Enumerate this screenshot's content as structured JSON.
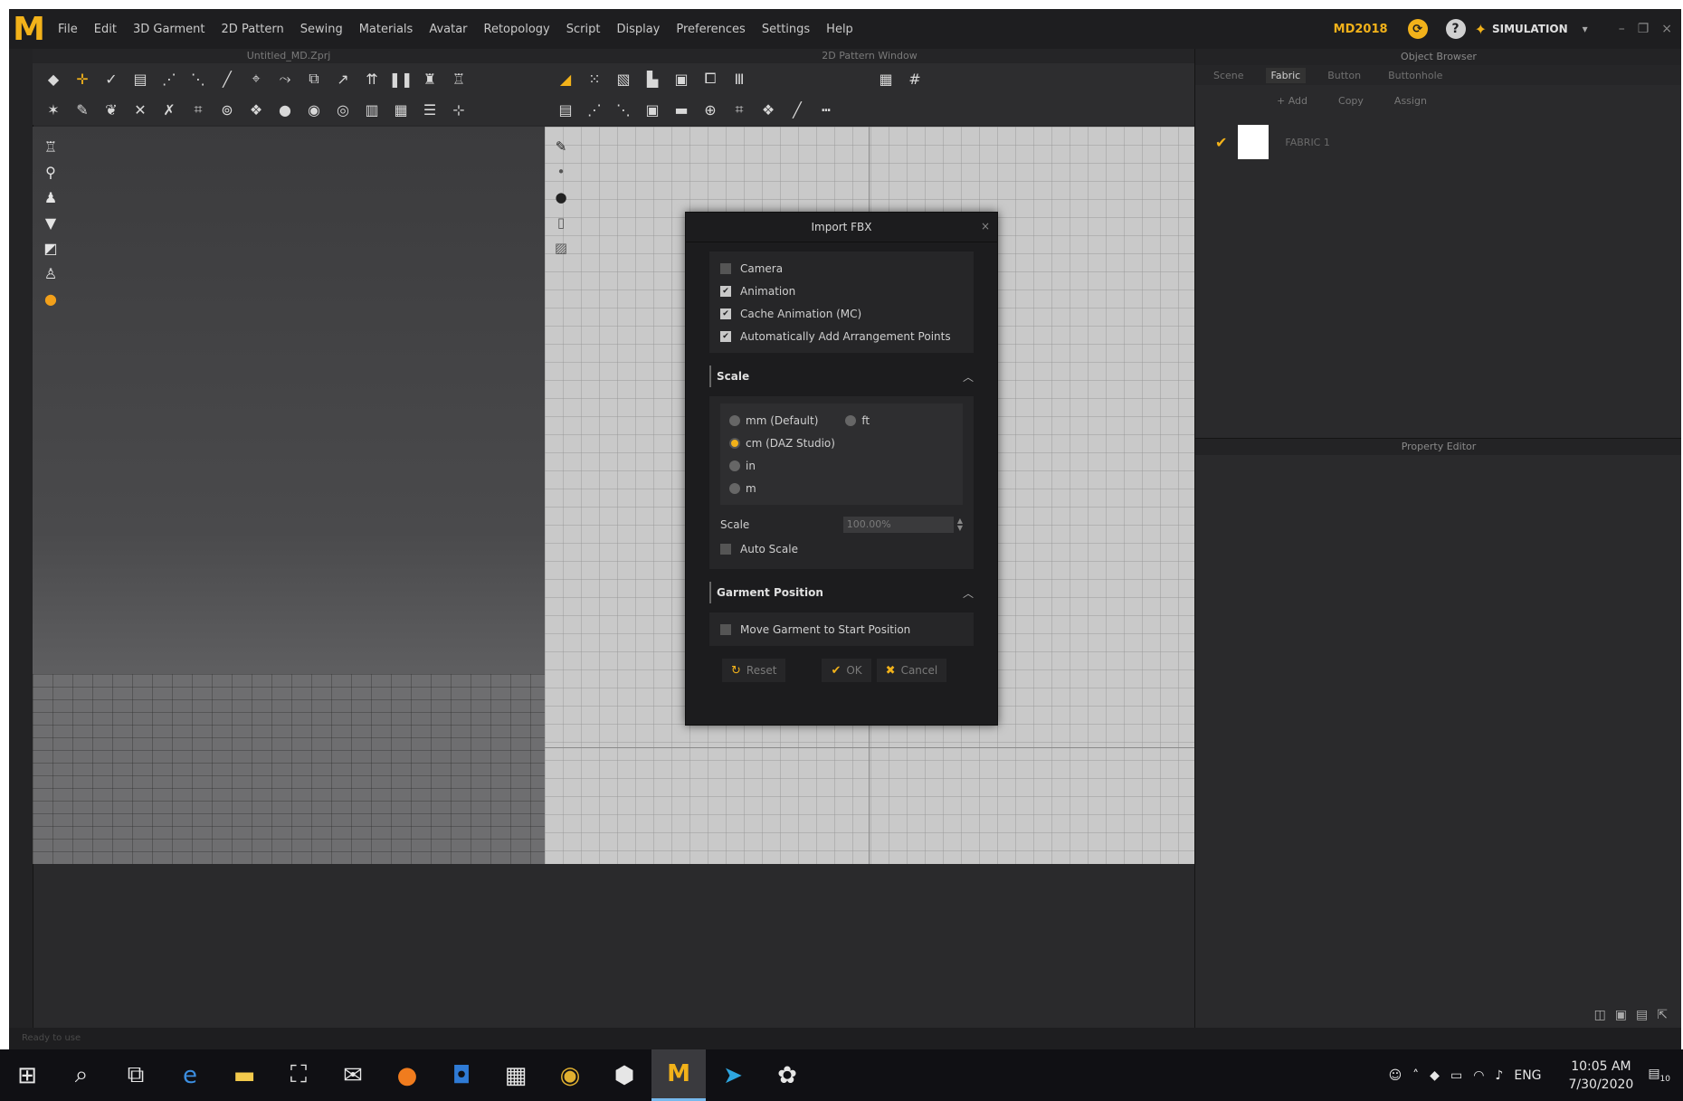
{
  "app": {
    "logo_letter": "M",
    "menu": [
      "File",
      "Edit",
      "3D Garment",
      "2D Pattern",
      "Sewing",
      "Materials",
      "Avatar",
      "Retopology",
      "Script",
      "Display",
      "Preferences",
      "Settings",
      "Help"
    ],
    "version_label": "MD2018",
    "mode_label": "SIMULATION",
    "accent_color": "#f2b21a"
  },
  "panels": {
    "panel3d_title": "Untitled_MD.Zprj",
    "panel2d_title": "2D Pattern Window",
    "object_browser_title": "Object Browser",
    "property_editor_title": "Property Editor"
  },
  "object_browser": {
    "tabs": [
      "Scene",
      "Fabric",
      "Button",
      "Buttonhole"
    ],
    "active_tab": "Fabric",
    "add_label": "+ Add",
    "copy_label": "Copy",
    "assign_label": "Assign",
    "fabric_name": "FABRIC 1"
  },
  "dialog": {
    "title": "Import FBX",
    "close": "×",
    "options": [
      {
        "label": "Camera",
        "checked": false
      },
      {
        "label": "Animation",
        "checked": true
      },
      {
        "label": "Cache Animation (MC)",
        "checked": true
      },
      {
        "label": "Automatically Add Arrangement Points",
        "checked": true
      }
    ],
    "scale_header": "Scale",
    "units": {
      "mm": "mm (Default)",
      "ft": "ft",
      "cm": "cm (DAZ Studio)",
      "in": "in",
      "m": "m",
      "selected": "cm"
    },
    "scale_label": "Scale",
    "scale_value": "100.00%",
    "auto_scale_label": "Auto Scale",
    "garment_position_header": "Garment Position",
    "move_garment_label": "Move Garment to Start Position",
    "reset_label": "Reset",
    "ok_label": "OK",
    "cancel_label": "Cancel"
  },
  "status_bar": {
    "text": "Ready to use"
  },
  "taskbar": {
    "time": "10:05 AM",
    "date": "7/30/2020",
    "language": "ENG",
    "notification_count": "10"
  }
}
